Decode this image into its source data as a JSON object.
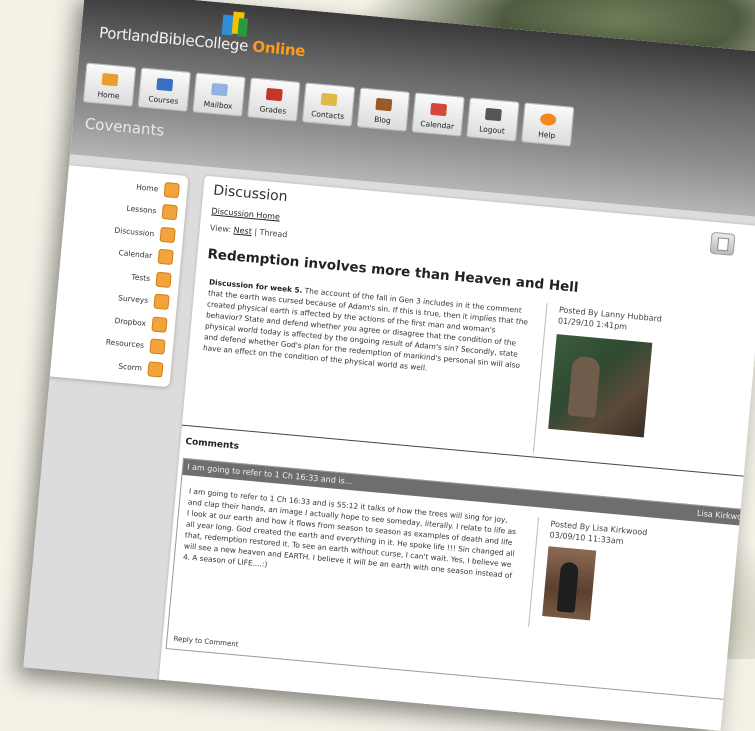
{
  "brand": {
    "name": "PortlandBibleCollege",
    "accent": "Online"
  },
  "nav": [
    {
      "label": "Home",
      "icon": "house-icon",
      "color": "#e7a02d"
    },
    {
      "label": "Courses",
      "icon": "books-icon",
      "color": "#3a6fc4"
    },
    {
      "label": "Mailbox",
      "icon": "envelope-icon",
      "color": "#8fb4e0"
    },
    {
      "label": "Grades",
      "icon": "gradebook-icon",
      "color": "#c6352c"
    },
    {
      "label": "Contacts",
      "icon": "contacts-icon",
      "color": "#e1b84a"
    },
    {
      "label": "Blog",
      "icon": "blog-icon",
      "color": "#9a5b28"
    },
    {
      "label": "Calendar",
      "icon": "calendar-icon",
      "color": "#d6463a"
    },
    {
      "label": "Logout",
      "icon": "logout-icon",
      "color": "#555555"
    },
    {
      "label": "Help",
      "icon": "help-icon",
      "color": "#f08a1c"
    }
  ],
  "section_title": "Covenants",
  "sidebar": [
    {
      "label": "Home",
      "icon": "house-icon"
    },
    {
      "label": "Lessons",
      "icon": "lessons-icon"
    },
    {
      "label": "Discussion",
      "icon": "discussion-icon"
    },
    {
      "label": "Calendar",
      "icon": "calendar-icon"
    },
    {
      "label": "Tests",
      "icon": "tests-icon"
    },
    {
      "label": "Surveys",
      "icon": "surveys-icon"
    },
    {
      "label": "Dropbox",
      "icon": "dropbox-icon"
    },
    {
      "label": "Resources",
      "icon": "resources-icon"
    },
    {
      "label": "Scorm",
      "icon": "scorm-icon"
    }
  ],
  "discussion": {
    "title": "Discussion",
    "home_link": "Discussion Home",
    "view_label": "View:",
    "view_nest": "Nest",
    "view_sep": "|",
    "view_thread": "Thread",
    "topic": "Redemption involves more than Heaven and Hell",
    "post_lead": "Discussion for week 5.",
    "post_body": "The account of the fall in Gen 3 includes in it the comment that the earth was cursed because of Adam's sin. If this is true, then it implies that the created physical earth is affected by the actions of the first man and woman's behavior? State and defend whether you agree or disagree that the condition of the physical world today is affected by the ongoing result of Adam's sin? Secondly, state and defend whether God's plan for the redemption of mankind's personal sin will also have an effect on the condition of the physical world as well.",
    "posted_by": "Posted By Lanny Hubbard",
    "posted_date": "01/29/10 1:41pm"
  },
  "comments": {
    "heading": "Comments",
    "items": [
      {
        "subject": "I am going to refer to 1 Ch 16:33 and is...",
        "author": "Lisa Kirkwood",
        "body": "I am going to refer to 1 Ch 16:33 and is 55:12 it talks of how the trees will sing for joy, and clap their hands, an image I actually hope to see someday, literally. I relate to life as I look at our earth and how it flows from season to season as examples of death and life all year long. God created the earth and everything in it. He spoke life !!! Sin changed all that, redemption restored it. To see an earth without curse, I can't wait. Yes, I believe we will see a new heaven and EARTH. I believe it will be an earth with one season instead of 4. A season of LIFE....:)",
        "posted_by": "Posted By Lisa Kirkwood",
        "posted_date": "03/09/10 11:33am",
        "reply": "Reply to Comment"
      }
    ]
  }
}
